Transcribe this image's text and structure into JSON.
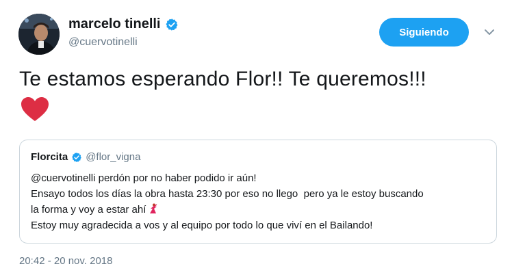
{
  "author": {
    "display_name": "marcelo tinelli",
    "handle": "@cuervotinelli",
    "avatar_icon": "profile-photo"
  },
  "follow_button": {
    "label": "Siguiendo",
    "color": "#1da1f2"
  },
  "tweet": {
    "text": "Te estamos esperando Flor!! Te queremos!!!",
    "emoji": "red-heart",
    "timestamp": "20:42 - 20 nov. 2018"
  },
  "quoted_tweet": {
    "display_name": "Florcita",
    "handle": "@flor_vigna",
    "lines": [
      "@cuervotinelli perdón por no haber podido ir aún!",
      "Ensayo todos los días la obra hasta 23:30 por eso no llego  pero ya le estoy buscando",
      "la forma y voy a estar ahí",
      "Estoy muy agradecida a vos y al equipo por todo lo que viví en el Bailando!"
    ],
    "emoji": "dancer"
  },
  "colors": {
    "verified_blue": "#1da1f2",
    "secondary_text": "#657786",
    "heart_red": "#dd2e44"
  }
}
